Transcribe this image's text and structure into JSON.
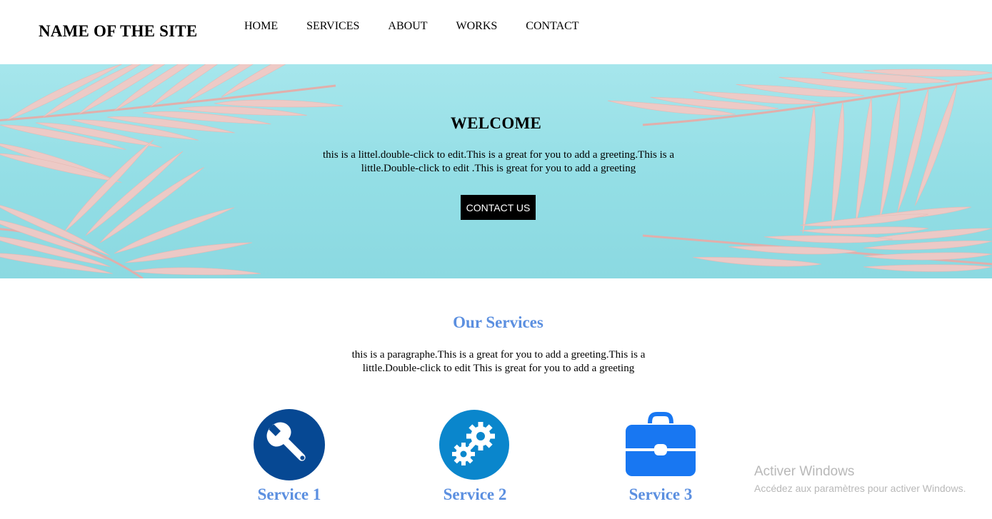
{
  "header": {
    "site_title": "NAME OF THE SITE",
    "nav": [
      "HOME",
      "SERVICES",
      "ABOUT",
      "WORKS",
      "CONTACT"
    ]
  },
  "hero": {
    "title": "WELCOME",
    "text": "this is a littel.double-click to edit.This is a great for you to add a greeting.This is a little.Double-click to edit .This is great for you to add a greeting",
    "button_label": "CONTACT US"
  },
  "services": {
    "title": "Our Services",
    "text": "this is a paragraphe.This is a great for you to add a greeting.This is a little.Double-click to edit This is great for you to add a greeting",
    "items": [
      {
        "label": "Service 1",
        "icon": "wrench-icon",
        "color": "#064893"
      },
      {
        "label": "Service 2",
        "icon": "gears-icon",
        "color": "#0a86cc"
      },
      {
        "label": "Service 3",
        "icon": "briefcase-icon",
        "color": "#1877f2"
      }
    ]
  },
  "watermark": {
    "line1": "Activer Windows",
    "line2": "Accédez aux paramètres pour activer Windows."
  },
  "colors": {
    "accent": "#5b8fe0",
    "hero_bg": "#93dee5",
    "leaf": "#f2c9c4",
    "button_bg": "#000000"
  }
}
